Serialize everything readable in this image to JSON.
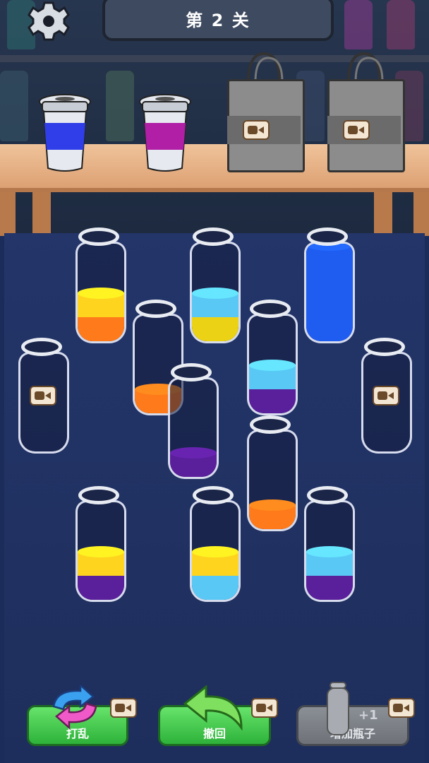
{
  "header": {
    "level_text": "第 2 关"
  },
  "icons": {
    "settings": "gear-icon",
    "video": "video-camera-icon",
    "shuffle": "shuffle-arrows-icon",
    "undo": "undo-arrow-icon",
    "add_bottle": "bottle-icon"
  },
  "cups": [
    {
      "color": "#2f3ee8"
    },
    {
      "color": "#b01fa6"
    }
  ],
  "tubes": [
    {
      "layers": [
        "#ff7a1a",
        "#ffd41e"
      ]
    },
    {
      "layers": [
        "#ecd214",
        "#59c8f5"
      ]
    },
    {
      "layers": [
        "#1f5cf0",
        "#1f5cf0",
        "#1f5cf0",
        "#1f5cf0"
      ]
    },
    {
      "layers": [
        "#ff7a1a"
      ]
    },
    {
      "layers": [
        "#5a1f9a",
        "#59c8f5"
      ]
    },
    {
      "layers": []
    },
    {
      "layers": []
    },
    {
      "layers": [
        "#5a1f9a"
      ]
    },
    {
      "layers": [
        "#ff7a1a"
      ]
    },
    {
      "layers": [
        "#5a1f9a",
        "#ffd41e"
      ]
    },
    {
      "layers": [
        "#59c8f5",
        "#ffd41e"
      ]
    },
    {
      "layers": [
        "#5a1f9a",
        "#59c8f5"
      ]
    }
  ],
  "buttons": {
    "shuffle_label": "打乱",
    "undo_label": "撤回",
    "add_bottle_label": "增加瓶子",
    "add_bottle_badge": "+1"
  },
  "colors": {
    "board": "#213267",
    "button_green": "#3ccb46",
    "button_gray": "#7c8086"
  }
}
